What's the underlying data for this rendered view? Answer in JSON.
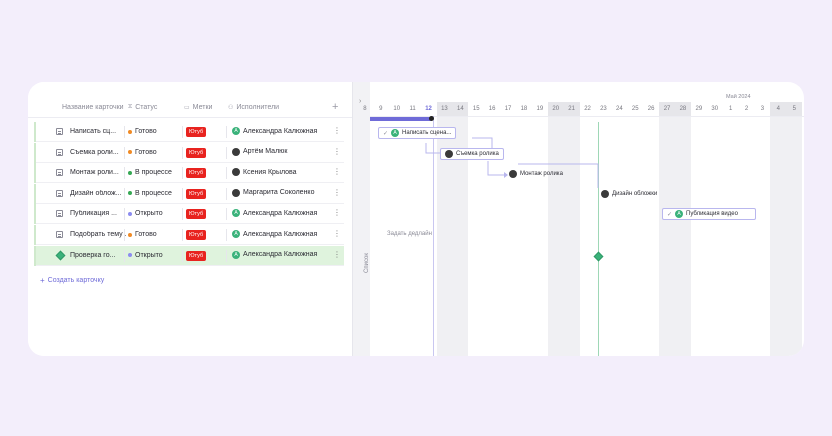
{
  "table": {
    "columns": {
      "name": "Название карточки",
      "status": "Статус",
      "tags": "Метки",
      "assignee": "Исполнители"
    },
    "rows": [
      {
        "name": "Написать сц...",
        "status": "Готово",
        "status_color": "#f08a24",
        "tag": "Ютуб",
        "assignee": "Александра Калюжная",
        "initial": "А",
        "avatar": "letter"
      },
      {
        "name": "Съемка роли...",
        "status": "Готово",
        "status_color": "#f08a24",
        "tag": "Ютуб",
        "assignee": "Артём Малюк",
        "initial": "",
        "avatar": "photo"
      },
      {
        "name": "Монтаж роли...",
        "status": "В процессе",
        "status_color": "#35a853",
        "tag": "Ютуб",
        "assignee": "Ксения Крылова",
        "initial": "",
        "avatar": "photo"
      },
      {
        "name": "Дизайн облож...",
        "status": "В процессе",
        "status_color": "#35a853",
        "tag": "Ютуб",
        "assignee": "Маргарита Соколенко",
        "initial": "",
        "avatar": "photo"
      },
      {
        "name": "Публикация ...",
        "status": "Открыто",
        "status_color": "#8c8cf0",
        "tag": "Ютуб",
        "assignee": "Александра Калюжная",
        "initial": "А",
        "avatar": "letter"
      },
      {
        "name": "Подобрать тему ...",
        "status": "Готово",
        "status_color": "#f08a24",
        "tag": "Ютуб",
        "assignee": "Александра Калюжная",
        "initial": "А",
        "avatar": "letter"
      },
      {
        "name": "Проверка го...",
        "status": "Открыто",
        "status_color": "#8c8cf0",
        "tag": "Ютуб",
        "assignee": "Александра Калюжная",
        "initial": "А",
        "avatar": "letter"
      }
    ],
    "create_label": "Создать карточку"
  },
  "side_panel": {
    "label": "Список"
  },
  "gantt": {
    "month_label": "Май 2024",
    "days": [
      "8",
      "9",
      "10",
      "11",
      "12",
      "13",
      "14",
      "15",
      "16",
      "17",
      "18",
      "19",
      "20",
      "21",
      "22",
      "23",
      "24",
      "25",
      "26",
      "27",
      "28",
      "29",
      "30",
      "1",
      "2",
      "3",
      "4",
      "5"
    ],
    "weekend_days": [
      "13",
      "14",
      "20",
      "21",
      "27",
      "28",
      "4",
      "5"
    ],
    "today": "12",
    "deadline_label": "Задать дедлайн",
    "tasks": [
      {
        "label": "Написать сцена...",
        "initial": "А"
      },
      {
        "label": "Съемка ролика",
        "initial": ""
      },
      {
        "label": "Монтаж ролика",
        "initial": ""
      },
      {
        "label": "Дизайн обложки",
        "initial": ""
      },
      {
        "label": "Публикация видео",
        "initial": "А"
      }
    ]
  },
  "colors": {
    "accent": "#6f6bd8",
    "tag_red": "#e8231f",
    "milestone_green": "#3ab27a"
  }
}
